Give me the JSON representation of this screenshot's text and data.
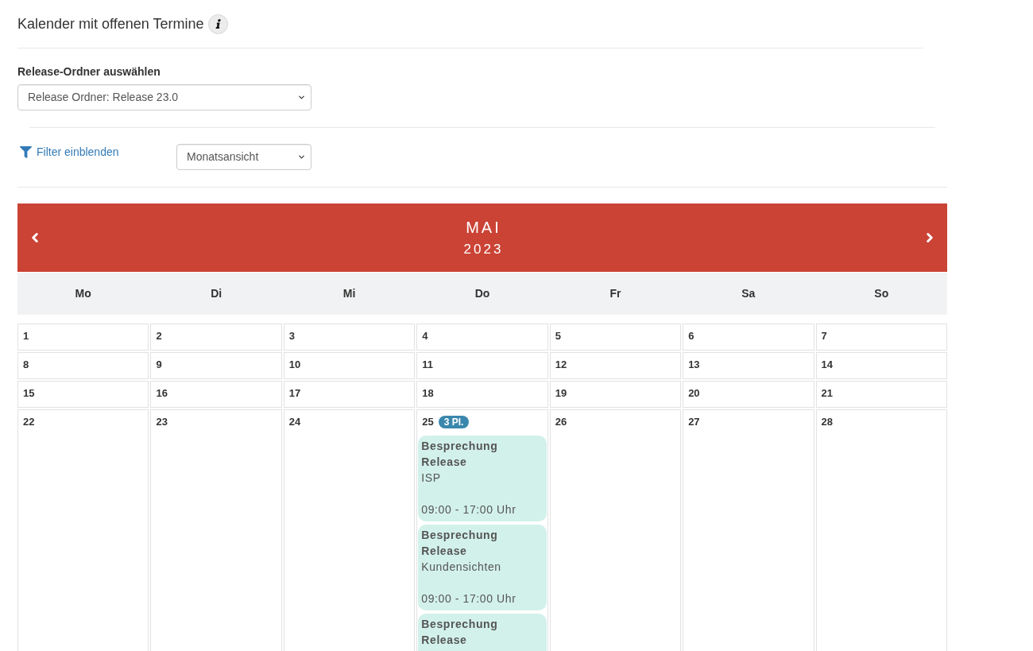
{
  "page": {
    "title": "Kalender mit offenen Termine"
  },
  "release_folder": {
    "label": "Release-Ordner auswählen",
    "value": "Release Ordner: Release 23.0"
  },
  "filter_link": {
    "label": "Filter einblenden"
  },
  "view_select": {
    "value": "Monatsansicht"
  },
  "calendar": {
    "month": "MAI",
    "year": "2023",
    "weekdays": [
      "Mo",
      "Di",
      "Mi",
      "Do",
      "Fr",
      "Sa",
      "So"
    ],
    "weeks": [
      [
        {
          "day": "1"
        },
        {
          "day": "2"
        },
        {
          "day": "3"
        },
        {
          "day": "4"
        },
        {
          "day": "5"
        },
        {
          "day": "6"
        },
        {
          "day": "7"
        }
      ],
      [
        {
          "day": "8"
        },
        {
          "day": "9"
        },
        {
          "day": "10"
        },
        {
          "day": "11"
        },
        {
          "day": "12"
        },
        {
          "day": "13"
        },
        {
          "day": "14"
        }
      ],
      [
        {
          "day": "15"
        },
        {
          "day": "16"
        },
        {
          "day": "17"
        },
        {
          "day": "18"
        },
        {
          "day": "19"
        },
        {
          "day": "20"
        },
        {
          "day": "21"
        }
      ],
      [
        {
          "day": "22"
        },
        {
          "day": "23"
        },
        {
          "day": "24"
        },
        {
          "day": "25",
          "badge": "3 Pl.",
          "events": [
            {
              "title": "Besprechung Release",
              "subtitle": "ISP",
              "time": "09:00 - 17:00 Uhr"
            },
            {
              "title": "Besprechung Release",
              "subtitle": "Kundensichten",
              "time": "09:00 - 17:00 Uhr"
            },
            {
              "title": "Besprechung Release"
            }
          ]
        },
        {
          "day": "26"
        },
        {
          "day": "27"
        },
        {
          "day": "28"
        }
      ]
    ]
  }
}
